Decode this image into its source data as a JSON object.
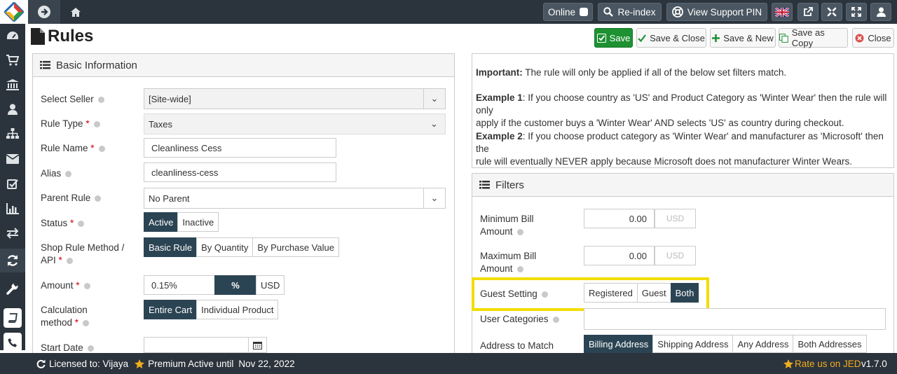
{
  "topbar": {
    "online_label": "Online",
    "reindex_label": "Re-index",
    "support_label": "View Support PIN",
    "flag_icon": "uk-flag-icon"
  },
  "page": {
    "title": "Rules"
  },
  "actions": {
    "save": "Save",
    "save_close": "Save & Close",
    "save_new": "Save & New",
    "save_copy": "Save as Copy",
    "close": "Close"
  },
  "basic": {
    "heading": "Basic Information",
    "seller_label": "Select Seller",
    "seller_value": "[Site-wide]",
    "ruletype_label": "Rule Type",
    "ruletype_value": "Taxes",
    "rulename_label": "Rule Name",
    "rulename_value": "Cleanliness Cess",
    "alias_label": "Alias",
    "alias_value": "cleanliness-cess",
    "parent_label": "Parent Rule",
    "parent_value": "No Parent",
    "status_label": "Status",
    "status_options": [
      "Active",
      "Inactive"
    ],
    "status_selected": "Active",
    "method_label_1": "Shop Rule Method /",
    "method_label_2": "API",
    "method_options": [
      "Basic Rule",
      "By Quantity",
      "By Purchase Value"
    ],
    "method_selected": "Basic Rule",
    "amount_label": "Amount",
    "amount_value": "0.15%",
    "amount_pct": "%",
    "amount_usd": "USD",
    "calc_label_1": "Calculation",
    "calc_label_2": "method",
    "calc_options": [
      "Entire Cart",
      "Individual Product"
    ],
    "calc_selected": "Entire Cart",
    "start_label": "Start Date"
  },
  "notes": {
    "important_bold": "Important:",
    "important_text": " The rule will only be applied if all of the below set filters match.",
    "ex1_bold": "Example 1",
    "ex1_text_1": ": If you choose country as 'US' and Product Category as 'Winter Wear' then the rule will only",
    "ex1_text_2": "apply if the customer buys a 'Winter Wear' AND selects 'US' as country during checkout.",
    "ex2_bold": "Example 2",
    "ex2_text_1": ": If you choose product category as 'Winter Wear' and manufacturer as 'Microsoft' then the",
    "ex2_text_2": "rule will eventually NEVER apply because Microsoft does not manufacturer Winter Wears."
  },
  "filters": {
    "heading": "Filters",
    "min_label_1": "Minimum Bill",
    "min_label_2": "Amount",
    "min_value": "0.00",
    "min_currency": "USD",
    "max_label_1": "Maximum Bill",
    "max_label_2": "Amount",
    "max_value": "0.00",
    "max_currency": "USD",
    "guest_label": "Guest Setting",
    "guest_options": [
      "Registered",
      "Guest",
      "Both"
    ],
    "guest_selected": "Both",
    "usercat_label": "User Categories",
    "address_label": "Address to Match",
    "address_options": [
      "Billing Address",
      "Shipping Address",
      "Any Address",
      "Both Addresses"
    ],
    "address_selected": "Billing Address"
  },
  "footer": {
    "licensed": "Licensed to: Vijaya",
    "premium": "Premium Active until",
    "premium_date": "Nov 22, 2022",
    "rate": "Rate us on JED",
    "version": "v1.7.0"
  },
  "colors": {
    "accent": "#2b4453",
    "topbar": "#2b333c",
    "save_green": "#1e9133",
    "highlight": "#f2dd00"
  }
}
